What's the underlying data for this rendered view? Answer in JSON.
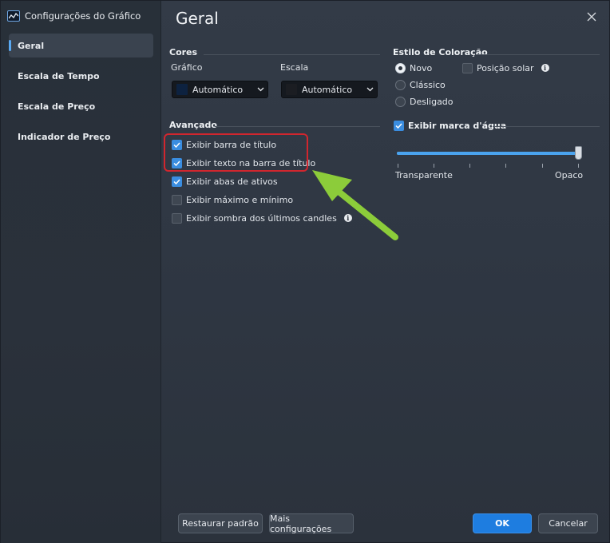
{
  "window": {
    "app_title": "Configurações do Gráfico",
    "page_title": "Geral",
    "close_icon": "close-icon"
  },
  "sidebar": {
    "items": [
      {
        "label": "Geral",
        "active": true
      },
      {
        "label": "Escala de Tempo",
        "active": false
      },
      {
        "label": "Escala de Preço",
        "active": false
      },
      {
        "label": "Indicador de Preço",
        "active": false
      }
    ]
  },
  "cores": {
    "title": "Cores",
    "grafico_label": "Gráfico",
    "grafico_value": "Automático",
    "grafico_swatch": "#0d2240",
    "escala_label": "Escala",
    "escala_value": "Automático",
    "escala_swatch": "#1b1d22"
  },
  "avancado": {
    "title": "Avançado",
    "options": [
      {
        "label": "Exibir barra de título",
        "checked": true
      },
      {
        "label": "Exibir texto na barra de título",
        "checked": true
      },
      {
        "label": "Exibir abas de ativos",
        "checked": true
      },
      {
        "label": "Exibir máximo e mínimo",
        "checked": false
      },
      {
        "label": "Exibir sombra dos últimos candles",
        "checked": false,
        "info": true
      }
    ]
  },
  "estilo": {
    "title": "Estilo de Coloração",
    "radios": [
      {
        "label": "Novo",
        "selected": true
      },
      {
        "label": "Clássico",
        "selected": false
      },
      {
        "label": "Desligado",
        "selected": false
      }
    ],
    "posicao_solar": {
      "label": "Posição solar",
      "checked": false
    }
  },
  "marca": {
    "label": "Exibir marca d'água",
    "checked": true,
    "slider_min_label": "Transparente",
    "slider_max_label": "Opaco",
    "slider_value": 1.0
  },
  "footer": {
    "restore_label": "Restaurar padrão",
    "more_label": "Mais configurações",
    "ok_label": "OK",
    "cancel_label": "Cancelar"
  },
  "colors": {
    "accent": "#1e7de0",
    "highlight": "#d1262e",
    "arrow": "#8ccc3a"
  }
}
